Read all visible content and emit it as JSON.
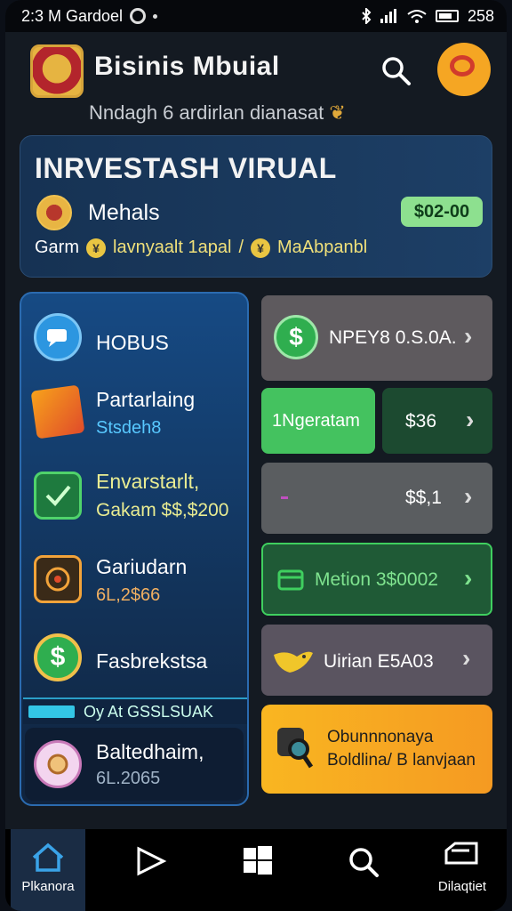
{
  "status_bar": {
    "time_left": "2:3 M Gardoel",
    "time_right": "258"
  },
  "header": {
    "title": "Bisinis Mbuial",
    "subtitle": "Nndagh 6 ardirlan dianasat"
  },
  "invest_card": {
    "heading": "INRVESTASH VIRUAL",
    "medals_label": "Mehals",
    "price": "$02-00",
    "row_prefix": "Garm",
    "row_item1": "lavnyaalt 1apal",
    "row_sep": "/",
    "row_item2": "MaAbpanbl"
  },
  "left_panel": {
    "items": [
      {
        "title": "HOBUS",
        "sub": "",
        "icon": "chat-icon"
      },
      {
        "title": "Partarlaing",
        "sub": "Stsdeh8",
        "icon": "tag-icon"
      },
      {
        "title": "Envarstarlt,",
        "sub": "Gakam $$,$200",
        "icon": "check-shield-icon"
      },
      {
        "title": "Gariudarn",
        "sub": "6L,2$66",
        "icon": "target-icon"
      },
      {
        "title": "Fasbrekstsa",
        "sub": "",
        "icon": "dollar-icon"
      },
      {
        "title": "Baltedhaim,",
        "sub": "6L.2065",
        "icon": "medal-icon"
      }
    ],
    "banner_text": "Oy At GSSLSUAK"
  },
  "right_cards": [
    {
      "label": "NPEY8 0.S.0A.",
      "icon": "dollar-circle-icon"
    },
    {
      "label_left": "1Ngeratam",
      "label_right": "$36"
    },
    {
      "label": "$$,1"
    },
    {
      "label": "Metion 3$0002",
      "icon": "calendar-icon"
    },
    {
      "label": "Uirian E5A03",
      "icon": "bird-icon"
    },
    {
      "line1": "Obunnnonaya",
      "line2": "Boldlina/ B lanvjaan",
      "icon": "magnifier-icon"
    }
  ],
  "bottom_nav": [
    {
      "label": "Plkanora",
      "icon": "home-icon"
    },
    {
      "label": "",
      "icon": "play-icon"
    },
    {
      "label": "",
      "icon": "windows-icon"
    },
    {
      "label": "",
      "icon": "search-icon"
    },
    {
      "label": "Dilaqtiet",
      "icon": "folder-icon"
    }
  ],
  "colors": {
    "accent_green": "#3fcf5f",
    "accent_orange": "#f5a623",
    "panel_blue": "#164a84"
  }
}
